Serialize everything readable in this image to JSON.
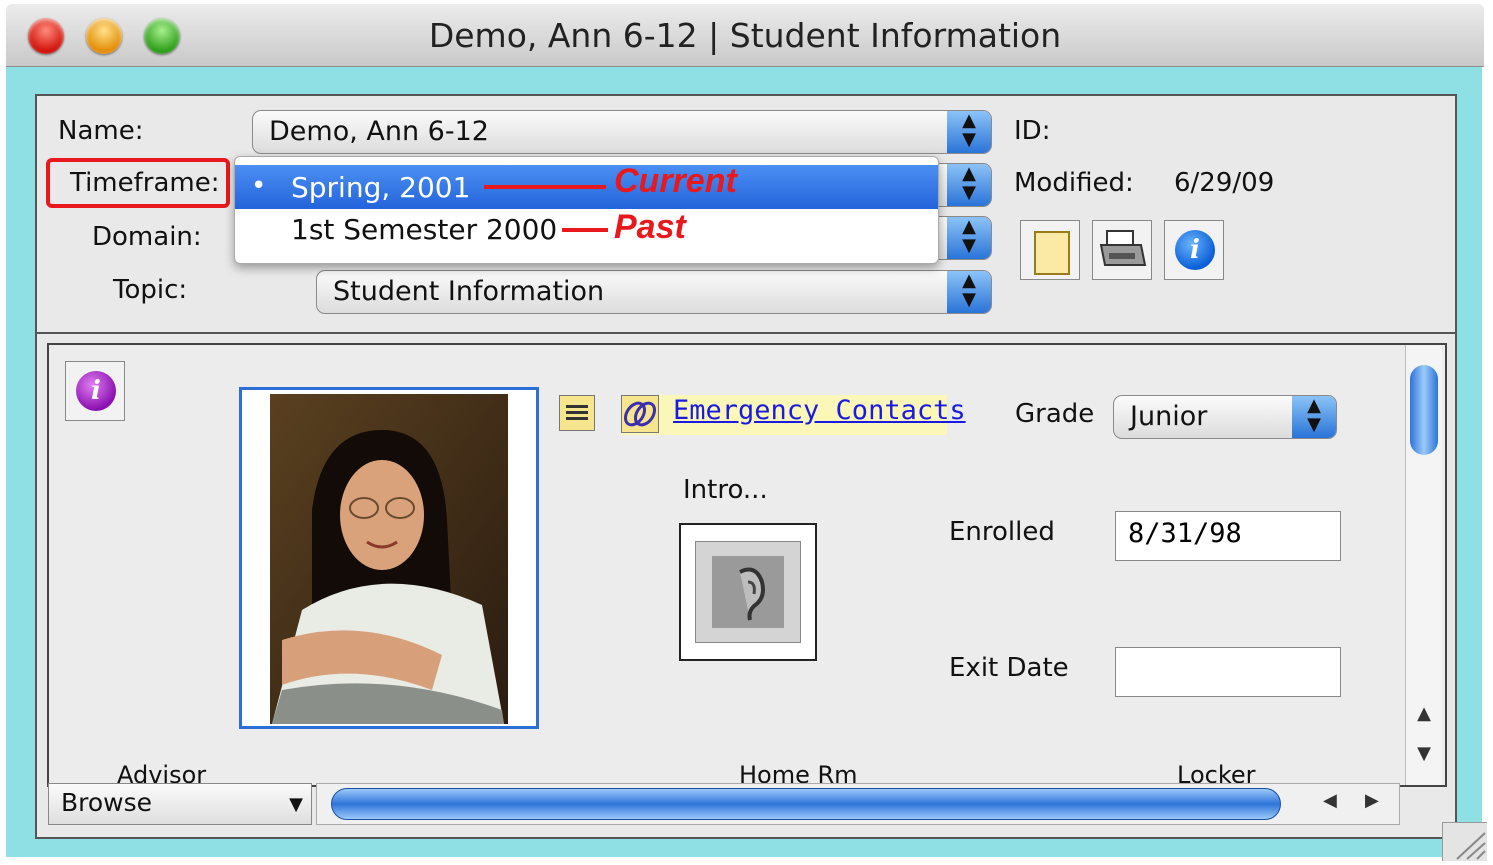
{
  "window": {
    "title": "Demo, Ann 6-12 | Student Information"
  },
  "header": {
    "name_label": "Name:",
    "name_value": "Demo, Ann 6-12",
    "timeframe_label": "Timeframe:",
    "domain_label": "Domain:",
    "topic_label": "Topic:",
    "topic_value": "Student Information",
    "id_label": "ID:",
    "modified_label": "Modified:",
    "modified_value": "6/29/09"
  },
  "timeframe_menu": {
    "items": [
      {
        "label": "Spring, 2001",
        "selected": true,
        "annotation": "Current"
      },
      {
        "label": "1st Semester 2000",
        "selected": false,
        "annotation": "Past"
      }
    ],
    "bullet": "•"
  },
  "record": {
    "emergency_link": "Emergency Contacts",
    "intro_label": "Intro...",
    "grade_label": "Grade",
    "grade_value": "Junior",
    "enrolled_label": "Enrolled",
    "enrolled_value": "8/31/98",
    "exit_label": "Exit Date",
    "exit_value": "",
    "advisor_label": "Advisor",
    "homeroom_label": "Home Rm",
    "locker_label": "Locker"
  },
  "footer": {
    "mode_value": "Browse"
  },
  "colors": {
    "highlight": "#e8181c",
    "selection": "#2f6fe0",
    "frame": "#8ee0e4"
  }
}
